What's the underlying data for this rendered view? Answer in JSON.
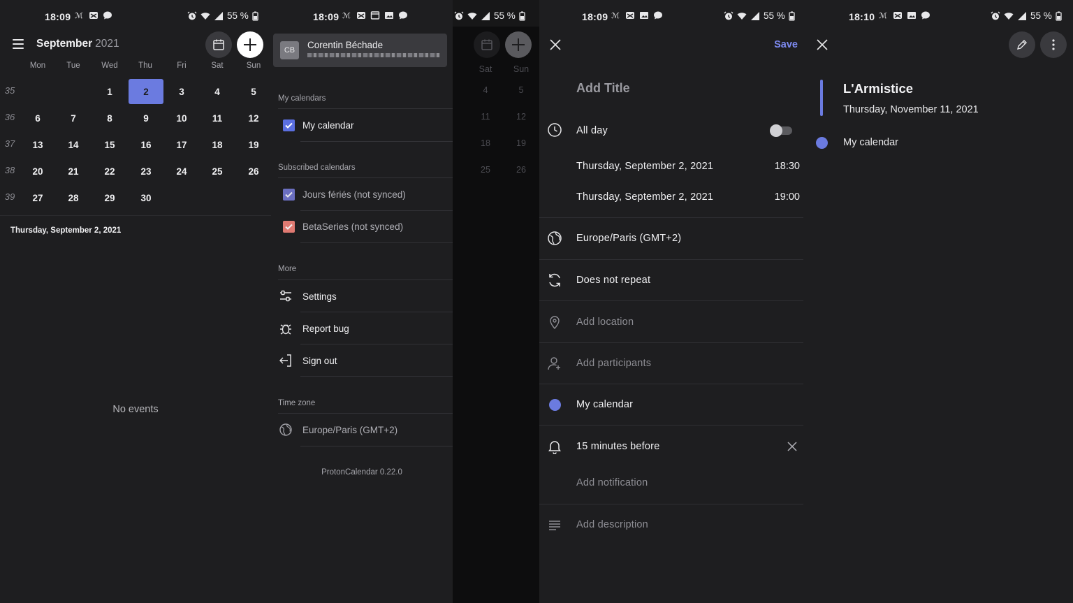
{
  "status_bars": [
    {
      "time": "18:09",
      "battery": "55 %"
    },
    {
      "time": "18:09",
      "battery": "55 %"
    },
    {
      "time": "18:09",
      "battery": "55 %"
    },
    {
      "time": "18:10",
      "battery": "55 %"
    }
  ],
  "calendar_view": {
    "month": "September",
    "year": "2021",
    "weekdays": [
      "Mon",
      "Tue",
      "Wed",
      "Thu",
      "Fri",
      "Sat",
      "Sun"
    ],
    "weeks": [
      {
        "num": "35",
        "days": [
          "",
          "",
          "1",
          "2",
          "3",
          "4",
          "5"
        ]
      },
      {
        "num": "36",
        "days": [
          "6",
          "7",
          "8",
          "9",
          "10",
          "11",
          "12"
        ]
      },
      {
        "num": "37",
        "days": [
          "13",
          "14",
          "15",
          "16",
          "17",
          "18",
          "19"
        ]
      },
      {
        "num": "38",
        "days": [
          "20",
          "21",
          "22",
          "23",
          "24",
          "25",
          "26"
        ]
      },
      {
        "num": "39",
        "days": [
          "27",
          "28",
          "29",
          "30",
          "",
          "",
          ""
        ]
      }
    ],
    "selected_day": "2",
    "selected_date_label": "Thursday, September 2, 2021",
    "empty_message": "No events"
  },
  "drawer": {
    "account_initials": "CB",
    "account_name": "Corentin Béchade",
    "my_calendars_title": "My calendars",
    "my_calendars": [
      {
        "label": "My calendar",
        "color": "#5b6fe0",
        "checked": true
      }
    ],
    "subscribed_title": "Subscribed calendars",
    "subscribed": [
      {
        "label": "Jours fériés (not synced)",
        "color": "#6b6fc0",
        "checked": true
      },
      {
        "label": "BetaSeries (not synced)",
        "color": "#e07a72",
        "checked": true
      }
    ],
    "more_title": "More",
    "more_items": [
      {
        "label": "Settings",
        "icon": "sliders-icon"
      },
      {
        "label": "Report bug",
        "icon": "bug-icon"
      },
      {
        "label": "Sign out",
        "icon": "sign-out-icon"
      }
    ],
    "timezone_title": "Time zone",
    "timezone": "Europe/Paris (GMT+2)",
    "version": "ProtonCalendar 0.22.0",
    "behind": {
      "weekdays": [
        "Sat",
        "Sun"
      ],
      "rows": [
        [
          "4",
          "5"
        ],
        [
          "11",
          "12"
        ],
        [
          "18",
          "19"
        ],
        [
          "25",
          "26"
        ]
      ]
    }
  },
  "editor": {
    "save_label": "Save",
    "title_placeholder": "Add Title",
    "all_day_label": "All day",
    "all_day_on": false,
    "start_date": "Thursday, September 2, 2021",
    "start_time": "18:30",
    "end_date": "Thursday, September 2, 2021",
    "end_time": "19:00",
    "timezone": "Europe/Paris (GMT+2)",
    "repeat": "Does not repeat",
    "location_placeholder": "Add location",
    "participants_placeholder": "Add participants",
    "calendar": "My calendar",
    "notification": "15 minutes before",
    "add_notification": "Add notification",
    "description_placeholder": "Add description",
    "accent": "#7d8af0"
  },
  "event_detail": {
    "title": "L'Armistice",
    "date": "Thursday, November 11, 2021",
    "calendar": "My calendar",
    "color": "#6b7be0"
  }
}
